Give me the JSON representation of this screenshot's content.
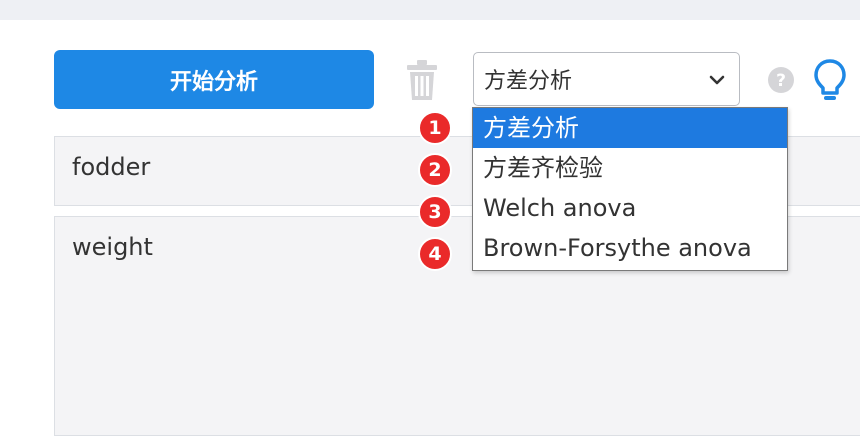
{
  "toolbar": {
    "start_label": "开始分析",
    "selected_method": "方差分析"
  },
  "fields": {
    "factor": "fodder",
    "response": "weight"
  },
  "dropdown": {
    "options": [
      "方差分析",
      "方差齐检验",
      "Welch anova",
      "Brown-Forsythe anova"
    ],
    "selected_index": 0
  },
  "badges": [
    "1",
    "2",
    "3",
    "4"
  ],
  "colors": {
    "accent": "#1e88e5",
    "selected": "#1e7ae0",
    "badge": "#ea2a2a",
    "bulb": "#1e88e5"
  },
  "icons": {
    "trash": "trash-icon",
    "chevron": "chevron-down-icon",
    "help": "help-icon",
    "bulb": "lightbulb-icon"
  }
}
